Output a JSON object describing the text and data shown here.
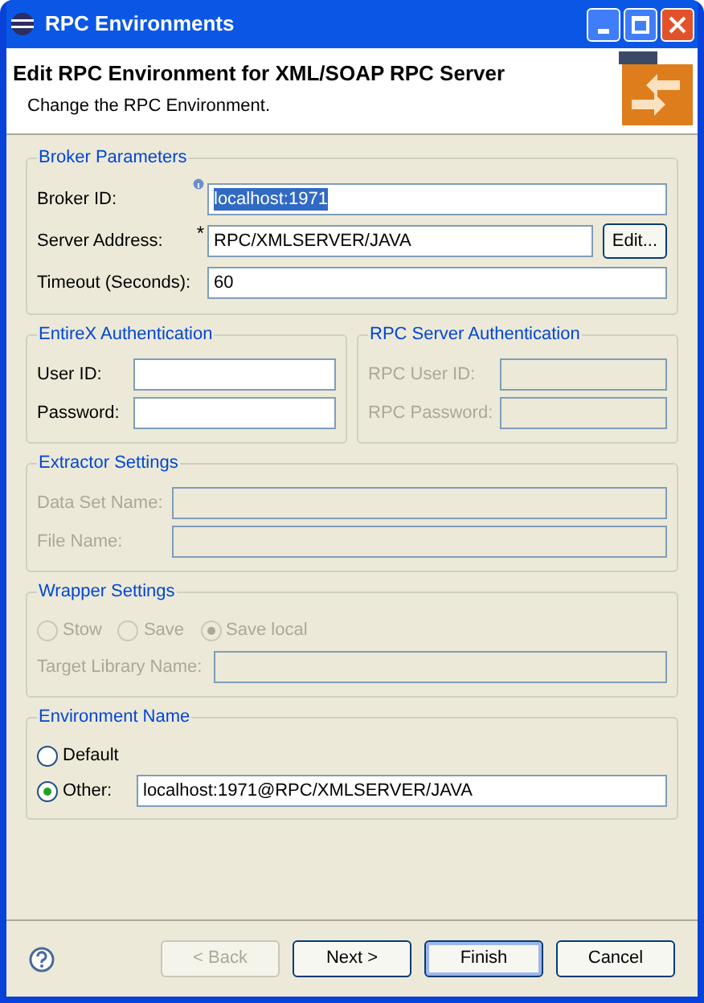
{
  "window": {
    "title": "RPC Environments"
  },
  "header": {
    "title": "Edit RPC Environment for XML/SOAP RPC Server",
    "subtitle": "Change the RPC Environment."
  },
  "broker_parameters": {
    "title": "Broker Parameters",
    "fields": [
      {
        "label": "Broker ID:",
        "value": "localhost:1971",
        "info": true,
        "text_selected": true,
        "disabled": false
      },
      {
        "label": "Server Address:",
        "value": "RPC/XMLSERVER/JAVA",
        "required_mark": "*",
        "button": "Edit...",
        "text_selected": false,
        "disabled": false
      },
      {
        "label": "Timeout (Seconds):",
        "value": "60",
        "text_selected": false,
        "disabled": false
      }
    ]
  },
  "entirex_authentication": {
    "title": "EntireX Authentication",
    "fields": [
      {
        "label": "User ID:",
        "disabled": false
      },
      {
        "label": "Password:",
        "disabled": false
      }
    ]
  },
  "rpc_server_authentication": {
    "title": "RPC Server Authentication",
    "fields": [
      {
        "label": "RPC User ID:",
        "disabled": true
      },
      {
        "label": "RPC Password:",
        "disabled": true
      }
    ]
  },
  "extractor_settings": {
    "title": "Extractor Settings",
    "fields": [
      {
        "label": "Data Set Name:",
        "disabled": true
      },
      {
        "label": "File Name:",
        "disabled": true
      }
    ]
  },
  "wrapper_settings": {
    "title": "Wrapper Settings",
    "options": [
      {
        "label": "Stow",
        "selected": false,
        "disabled": true
      },
      {
        "label": "Save",
        "selected": false,
        "disabled": true
      },
      {
        "label": "Save local",
        "selected": true,
        "disabled": true
      }
    ],
    "fields": [
      {
        "label": "Target Library Name:",
        "disabled": true
      }
    ]
  },
  "environment_name": {
    "title": "Environment Name",
    "options": [
      {
        "label": "Default",
        "selected": false,
        "disabled": false
      },
      {
        "label": "Other:",
        "selected": true,
        "disabled": false,
        "value": "localhost:1971@RPC/XMLSERVER/JAVA"
      }
    ]
  },
  "buttons": [
    {
      "label": "< Back",
      "disabled": true,
      "default": false
    },
    {
      "label": "Next >",
      "disabled": false,
      "default": false
    },
    {
      "label": "Finish",
      "disabled": false,
      "default": true
    },
    {
      "label": "Cancel",
      "disabled": false,
      "default": false
    }
  ]
}
